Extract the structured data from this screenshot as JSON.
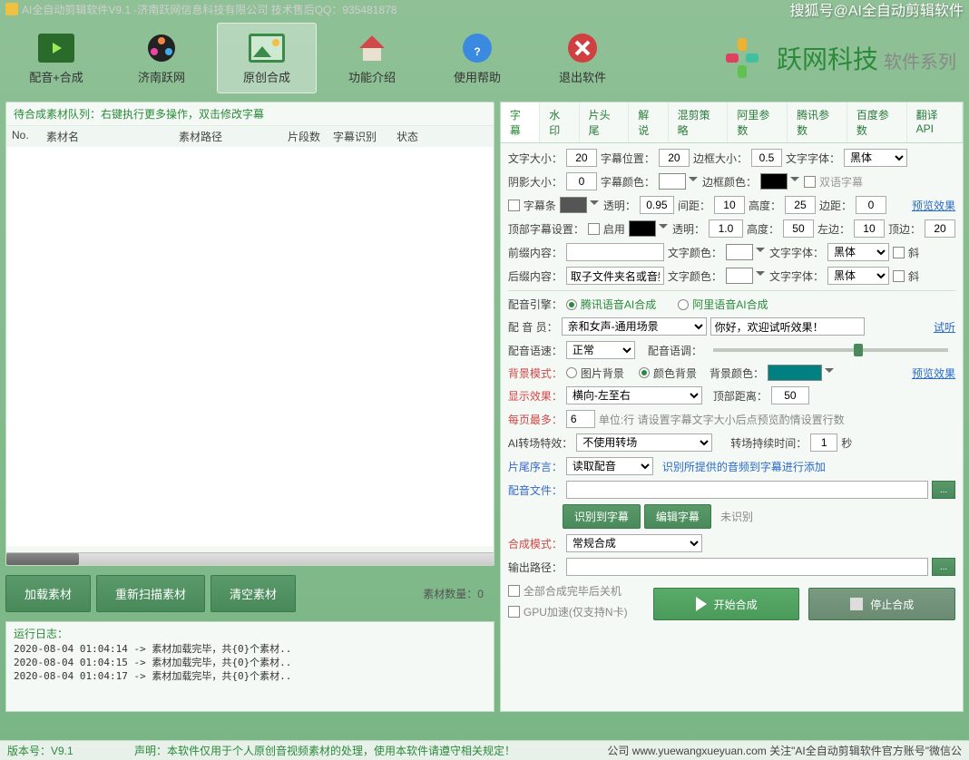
{
  "titlebar": {
    "title": "AI全自动剪辑软件V9.1 -济南跃网信息科技有限公司 技术售后QQ：935481878",
    "credit": "搜狐号@AI全自动剪辑软件"
  },
  "toolbar": {
    "items": [
      "配音+合成",
      "济南跃网",
      "原创合成",
      "功能介绍",
      "使用帮助",
      "退出软件"
    ]
  },
  "logo": {
    "main": "跃网科技",
    "sub": "软件系列"
  },
  "queue": {
    "title": "待合成素材队列：右键执行更多操作，双击修改字幕",
    "headers": [
      "No.",
      "素材名",
      "素材路径",
      "片段数",
      "字幕识别",
      "状态"
    ]
  },
  "btns": {
    "load": "加载素材",
    "rescan": "重新扫描素材",
    "clear": "清空素材",
    "matcount": "素材数量：0"
  },
  "log": {
    "title": "运行日志：",
    "lines": [
      "2020-08-04 01:04:14 -> 素材加载完毕，共{0}个素材..",
      "2020-08-04 01:04:15 -> 素材加载完毕，共{0}个素材..",
      "2020-08-04 01:04:17 -> 素材加载完毕，共{0}个素材.."
    ]
  },
  "tabs": [
    "字幕",
    "水印",
    "片头尾",
    "解说",
    "混剪策略",
    "阿里参数",
    "腾讯参数",
    "百度参数",
    "翻译API"
  ],
  "f": {
    "fontSize": "文字大小：",
    "fontSizeV": "20",
    "subPos": "字幕位置：",
    "subPosV": "20",
    "borderSize": "边框大小：",
    "borderSizeV": "0.5",
    "fontFace": "文字字体：",
    "fontFaceV": "黑体",
    "shadow": "阴影大小：",
    "shadowV": "0",
    "subColor": "字幕颜色：",
    "borderColor": "边框颜色：",
    "bilingual": "双语字幕",
    "subBar": "字幕条",
    "opacity": "透明：",
    "opacityV": "0.95",
    "gap": "间距：",
    "gapV": "10",
    "height": "高度：",
    "heightV": "25",
    "margin": "边距：",
    "marginV": "0",
    "preview": "预览效果",
    "topSub": "顶部字幕设置：",
    "enable": "启用",
    "opacity2V": "1.0",
    "height2V": "50",
    "left": "左边：",
    "leftV": "10",
    "top": "顶边：",
    "topV": "20",
    "prefix": "前缀内容：",
    "textColor": "文字颜色：",
    "textFont": "文字字体：",
    "textFontV": "黑体",
    "italic": "斜",
    "suffix": "后缀内容：",
    "suffixV": "取子文件夹名或音频",
    "voiceEngine": "配音引擎：",
    "tencent": "腾讯语音AI合成",
    "ali": "阿里语音AI合成",
    "voiceActor": "配 音 员：",
    "voiceActorV": "亲和女声-通用场景",
    "sampleText": "你好，欢迎试听效果！",
    "listen": "试听",
    "voiceSpeed": "配音语速：",
    "voiceSpeedV": "正常",
    "voiceTone": "配音语调：",
    "bgMode": "背景模式：",
    "imgBg": "图片背景",
    "colorBg": "颜色背景",
    "bgColor": "背景颜色：",
    "display": "显示效果：",
    "displayV": "横向-左至右",
    "topDist": "顶部距离：",
    "topDistV": "50",
    "perPage": "每页最多：",
    "perPageV": "6",
    "perPageHint": "单位:行 请设置字幕文字大小后点预览酌情设置行数",
    "transition": "AI转场特效：",
    "transitionV": "不使用转场",
    "transDur": "转场持续时间：",
    "transDurV": "1",
    "sec": "秒",
    "tailPrologue": "片尾序言：",
    "tailPrologueV": "读取配音",
    "tailHint": "识别所提供的音频到字幕进行添加",
    "voiceFile": "配音文件：",
    "recognize": "识别到字幕",
    "editSub": "编辑字幕",
    "notRecognized": "未识别",
    "synthMode": "合成模式：",
    "synthModeV": "常规合成",
    "outPath": "输出路径：",
    "shutdownAfter": "全部合成完毕后关机",
    "gpuAccel": "GPU加速(仅支持N卡)",
    "start": "开始合成",
    "stop": "停止合成"
  },
  "footer": {
    "ver": "版本号：V9.1",
    "disclaim": "声明：本软件仅用于个人原创音视频素材的处理，使用本软件请遵守相关规定！",
    "right": "公司 www.yuewangxueyuan.com 关注\"AI全自动剪辑软件官方账号\"微信公"
  }
}
